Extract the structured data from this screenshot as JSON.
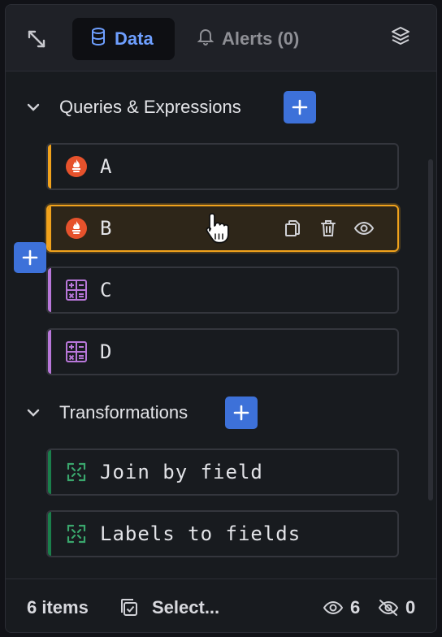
{
  "header": {
    "tabs": [
      {
        "label": "Data",
        "icon": "database-icon",
        "active": true
      },
      {
        "label": "Alerts (0)",
        "icon": "bell-icon",
        "active": false
      }
    ]
  },
  "queries": {
    "title": "Queries & Expressions",
    "items": [
      {
        "label": "A",
        "icon": "prometheus-icon",
        "type": "query",
        "stripe_color": "#f0a21c"
      },
      {
        "label": "B",
        "icon": "prometheus-icon",
        "type": "query",
        "stripe_color": "#f0a21c",
        "hovered": true
      },
      {
        "label": "C",
        "icon": "calculator-icon",
        "type": "expression",
        "stripe_color": "#b877d9"
      },
      {
        "label": "D",
        "icon": "calculator-icon",
        "type": "expression",
        "stripe_color": "#b877d9"
      }
    ]
  },
  "transformations": {
    "title": "Transformations",
    "items": [
      {
        "label": "Join by field",
        "icon": "transform-icon",
        "stripe_color": "#1a7f4b"
      },
      {
        "label": "Labels to fields",
        "icon": "transform-icon",
        "stripe_color": "#1a7f4b"
      }
    ]
  },
  "footer": {
    "count": "6 items",
    "select": "Select...",
    "visible_count": "6",
    "hidden_count": "0"
  },
  "colors": {
    "accent": "#3d71d9",
    "active_tab_text": "#6e9fff",
    "hover_border": "#f0a21c"
  }
}
